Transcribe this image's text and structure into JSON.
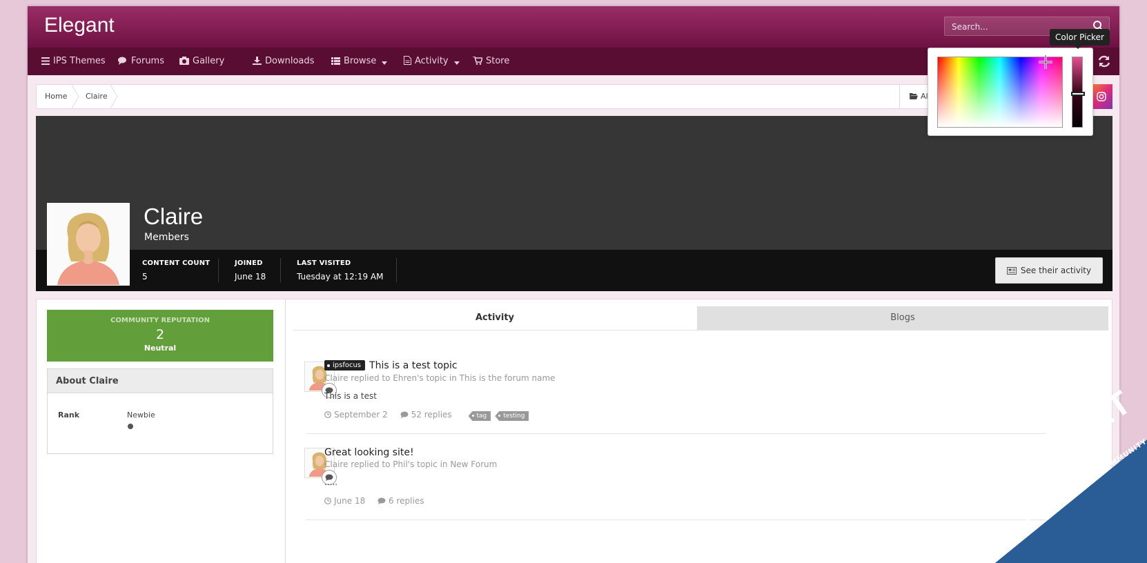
{
  "header": {
    "logo": "Elegant",
    "search_placeholder": "Search..."
  },
  "nav": {
    "items": [
      {
        "label": "IPS Themes",
        "icon": "menu-icon"
      },
      {
        "label": "Forums",
        "icon": "comments-icon"
      },
      {
        "label": "Gallery",
        "icon": "camera-icon"
      },
      {
        "label": "Downloads",
        "icon": "download-icon"
      },
      {
        "label": "Browse",
        "icon": "list-icon"
      },
      {
        "label": "Activity",
        "icon": "file-icon"
      },
      {
        "label": "Store",
        "icon": "cart-icon"
      }
    ]
  },
  "breadcrumb": {
    "home": "Home",
    "current": "Claire",
    "right_label": "Al"
  },
  "profile": {
    "name": "Claire",
    "group": "Members",
    "stats": [
      {
        "label": "CONTENT COUNT",
        "value": "5"
      },
      {
        "label": "JOINED",
        "value": "June 18"
      },
      {
        "label": "LAST VISITED",
        "value": "Tuesday at 12:19 AM"
      }
    ],
    "activity_button": "See their activity"
  },
  "reputation": {
    "label": "COMMUNITY REPUTATION",
    "value": "2",
    "text": "Neutral"
  },
  "about": {
    "title": "About Claire",
    "rank_label": "Rank",
    "rank_value": "Newbie"
  },
  "tabs": {
    "activity": "Activity",
    "blogs": "Blogs"
  },
  "feed": [
    {
      "prefix": "ipsfocus",
      "title": "This is a test topic",
      "sub": "Claire replied to Ehren's topic in This is the forum name",
      "body": "This is a test",
      "date": "September 2",
      "replies": "52 replies",
      "tags": [
        "tag",
        "testing"
      ]
    },
    {
      "title": "Great looking site!",
      "sub": "Claire replied to Phil's topic in New Forum",
      "body": ".....",
      "date": "June 18",
      "replies": "6 replies"
    }
  ],
  "color_picker": {
    "tooltip": "Color Picker"
  },
  "watermark": {
    "main": "ENXF.NET",
    "sub": "XENFORO PREMIUM COMMUNITY"
  },
  "colors": {
    "header": "#7b1a4d",
    "nav": "#5a0d33",
    "reputation": "#629e3a",
    "watermark": "#2a5d96"
  }
}
